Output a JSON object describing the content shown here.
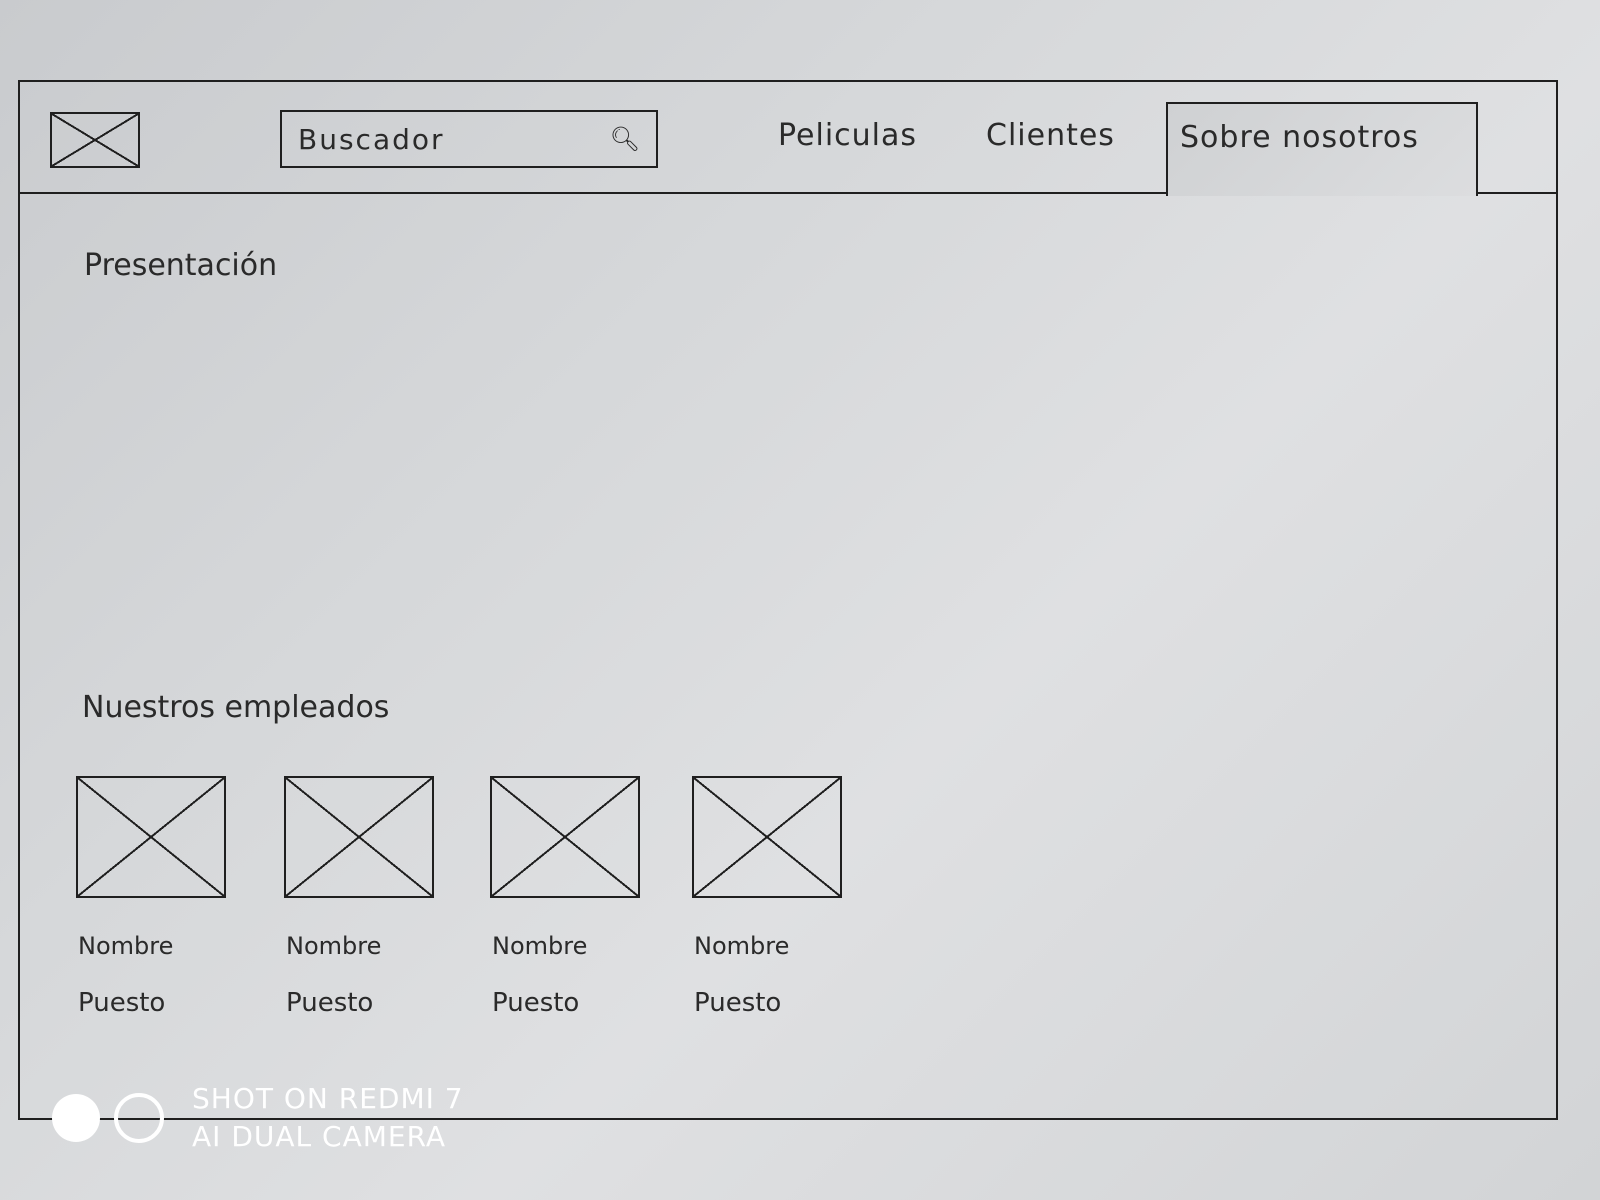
{
  "header": {
    "search": {
      "placeholder": "Buscador",
      "icon": "search-icon"
    },
    "nav": [
      {
        "label": "Peliculas"
      },
      {
        "label": "Clientes"
      },
      {
        "label": "Sobre nosotros",
        "active": true
      }
    ]
  },
  "main": {
    "presentation_title": "Presentación",
    "employees_title": "Nuestros empleados",
    "employees": [
      {
        "name": "Nombre",
        "role": "Puesto"
      },
      {
        "name": "Nombre",
        "role": "Puesto"
      },
      {
        "name": "Nombre",
        "role": "Puesto"
      },
      {
        "name": "Nombre",
        "role": "Puesto"
      }
    ]
  },
  "watermark": {
    "line1": "SHOT ON REDMI 7",
    "line2": "AI DUAL CAMERA"
  }
}
